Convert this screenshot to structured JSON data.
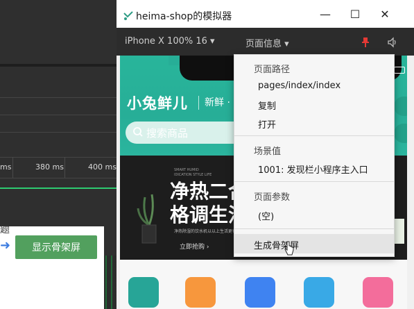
{
  "devtools": {
    "timeline_ticks": [
      "ms",
      "380 ms",
      "400 ms"
    ],
    "panel_fragment": "题",
    "show_skeleton_button": "显示骨架屏"
  },
  "simulator": {
    "window_title": "heima-shop的模拟器",
    "device_label": "iPhone X 100% 16 ▾",
    "page_info_label": "页面信息 ▾",
    "window_buttons": {
      "minimize": "—",
      "maximize": "☐",
      "close": "✕"
    },
    "pin_icon_color": "#e53935"
  },
  "app": {
    "brand": "小兔鲜儿",
    "slogan": "新鲜 ·",
    "search_placeholder": "搜索商品",
    "banner": {
      "small_text": "SMART HUMID IDICATION STYLE LIFE",
      "title_line1": "净热二合",
      "title_line2": "格调生活",
      "description": "净热除湿的饮水机以以上生活更有品质感",
      "cta": "立即抢购 ›"
    },
    "category_colors": [
      "#27a597",
      "#f7973d",
      "#3f83f1",
      "#39a9e6",
      "#f36d9b"
    ]
  },
  "page_info_menu": {
    "path_header": "页面路径",
    "path_value": "pages/index/index",
    "copy": "复制",
    "open": "打开",
    "scene_header": "场景值",
    "scene_value": "1001: 发现栏小程序主入口",
    "params_header": "页面参数",
    "params_value": "(空)",
    "generate_skeleton": "生成骨架屏"
  }
}
